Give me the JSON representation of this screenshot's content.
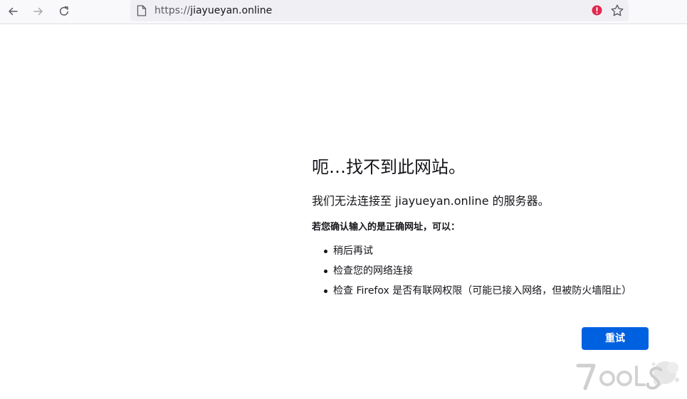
{
  "browser": {
    "url_scheme": "https://",
    "url_host": "jiayueyan.online",
    "icons": {
      "back": "back-arrow-icon",
      "forward": "forward-arrow-icon",
      "reload": "reload-icon",
      "page": "page-icon",
      "warning": "warning-icon",
      "bookmark": "star-icon"
    }
  },
  "error_page": {
    "title": "呃…找不到此网站。",
    "intro": "我们无法连接至 jiayueyan.online 的服务器。",
    "advice_heading": "若您确认输入的是正确网址，可以：",
    "tips": [
      "稍后再试",
      "检查您的网络连接",
      "检查 Firefox 是否有联网权限（可能已接入网络，但被防火墙阻止）"
    ],
    "retry_label": "重试"
  },
  "colors": {
    "primary_button": "#0061e0",
    "warning": "#e22850",
    "text": "#15141a",
    "toolbar": "#f9f9fb",
    "urlbar": "#f0f0f4"
  }
}
